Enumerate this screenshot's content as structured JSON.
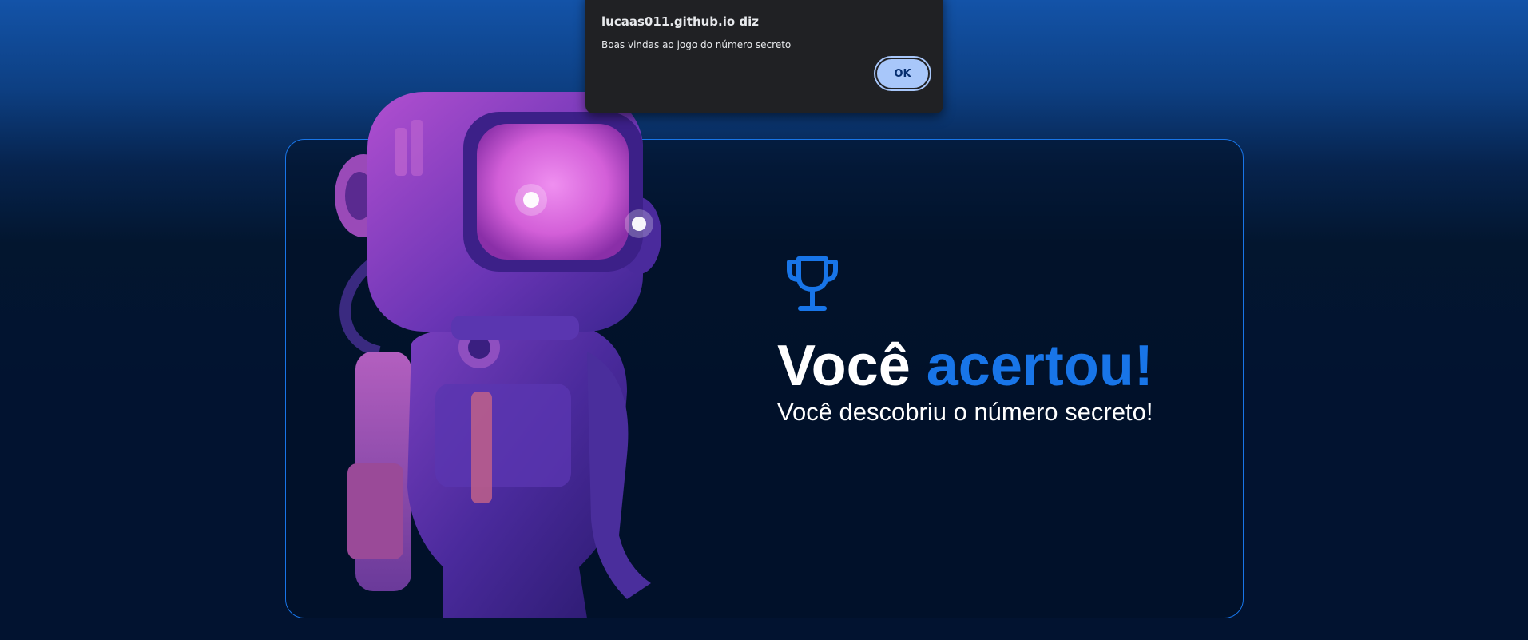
{
  "dialog": {
    "origin": "lucaas011.github.io diz",
    "message": "Boas vindas ao jogo do número secreto",
    "ok_label": "OK"
  },
  "game": {
    "trophy_icon": "trophy-icon",
    "title_prefix": "Você",
    "title_accent": "acertou!",
    "subtitle": "Você descobriu o número secreto!",
    "accent_color": "#1875e8",
    "astronaut_image": "astronaut-robot-illustration"
  }
}
